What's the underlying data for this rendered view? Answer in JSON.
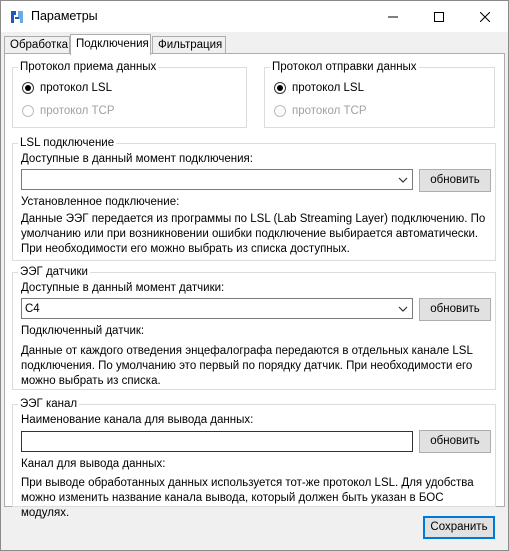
{
  "window": {
    "title": "Параметры"
  },
  "tabs": [
    {
      "label": "Обработка"
    },
    {
      "label": "Подключения"
    },
    {
      "label": "Фильтрация"
    }
  ],
  "receive_protocol": {
    "title": "Протокол приема данных",
    "options": [
      {
        "label": "протокол LSL",
        "checked": true,
        "enabled": true
      },
      {
        "label": "протокол TCP",
        "checked": false,
        "enabled": false
      }
    ]
  },
  "send_protocol": {
    "title": "Протокол отправки данных",
    "options": [
      {
        "label": "протокол LSL",
        "checked": true,
        "enabled": true
      },
      {
        "label": "протокол TCP",
        "checked": false,
        "enabled": false
      }
    ]
  },
  "lsl_connection": {
    "title": "LSL подключение",
    "available_label": "Доступные в данный момент подключения:",
    "selected_value": "",
    "refresh_label": "обновить",
    "established_label": "Установленное подключение:",
    "description": "Данные ЭЭГ передается из программы по LSL (Lab Streaming Layer) подключению. По умолчанию или при возникновении ошибки подключение выбирается автоматически. При необходимости его можно выбрать из списка доступных."
  },
  "eeg_sensors": {
    "title": "ЭЭГ датчики",
    "available_label": "Доступные в данный момент датчики:",
    "selected_value": "C4",
    "refresh_label": "обновить",
    "connected_label": "Подключенный датчик:",
    "description": "Данные от каждого отведения энцефалографа передаются в отдельных канале LSL подключения.  По умолчанию это первый по порядку датчик. При необходимости его можно выбрать из списка."
  },
  "eeg_channel": {
    "title": "ЭЭГ канал",
    "name_label": "Наименование канала для вывода данных:",
    "name_value": "",
    "refresh_label": "обновить",
    "output_label": "Канал для вывода данных:",
    "description": "При выводе обработанных данных используется тот-же протокол LSL. Для удобства можно изменить название канала вывода, который должен быть указан в БОС модулях."
  },
  "footer": {
    "save_label": "Сохранить"
  },
  "colors": {
    "accent": "#0078d7",
    "icon_blue": "#1e5bb8"
  },
  "icons": [
    "app-icon",
    "minimize-icon",
    "maximize-icon",
    "close-icon",
    "chevron-down-icon"
  ]
}
